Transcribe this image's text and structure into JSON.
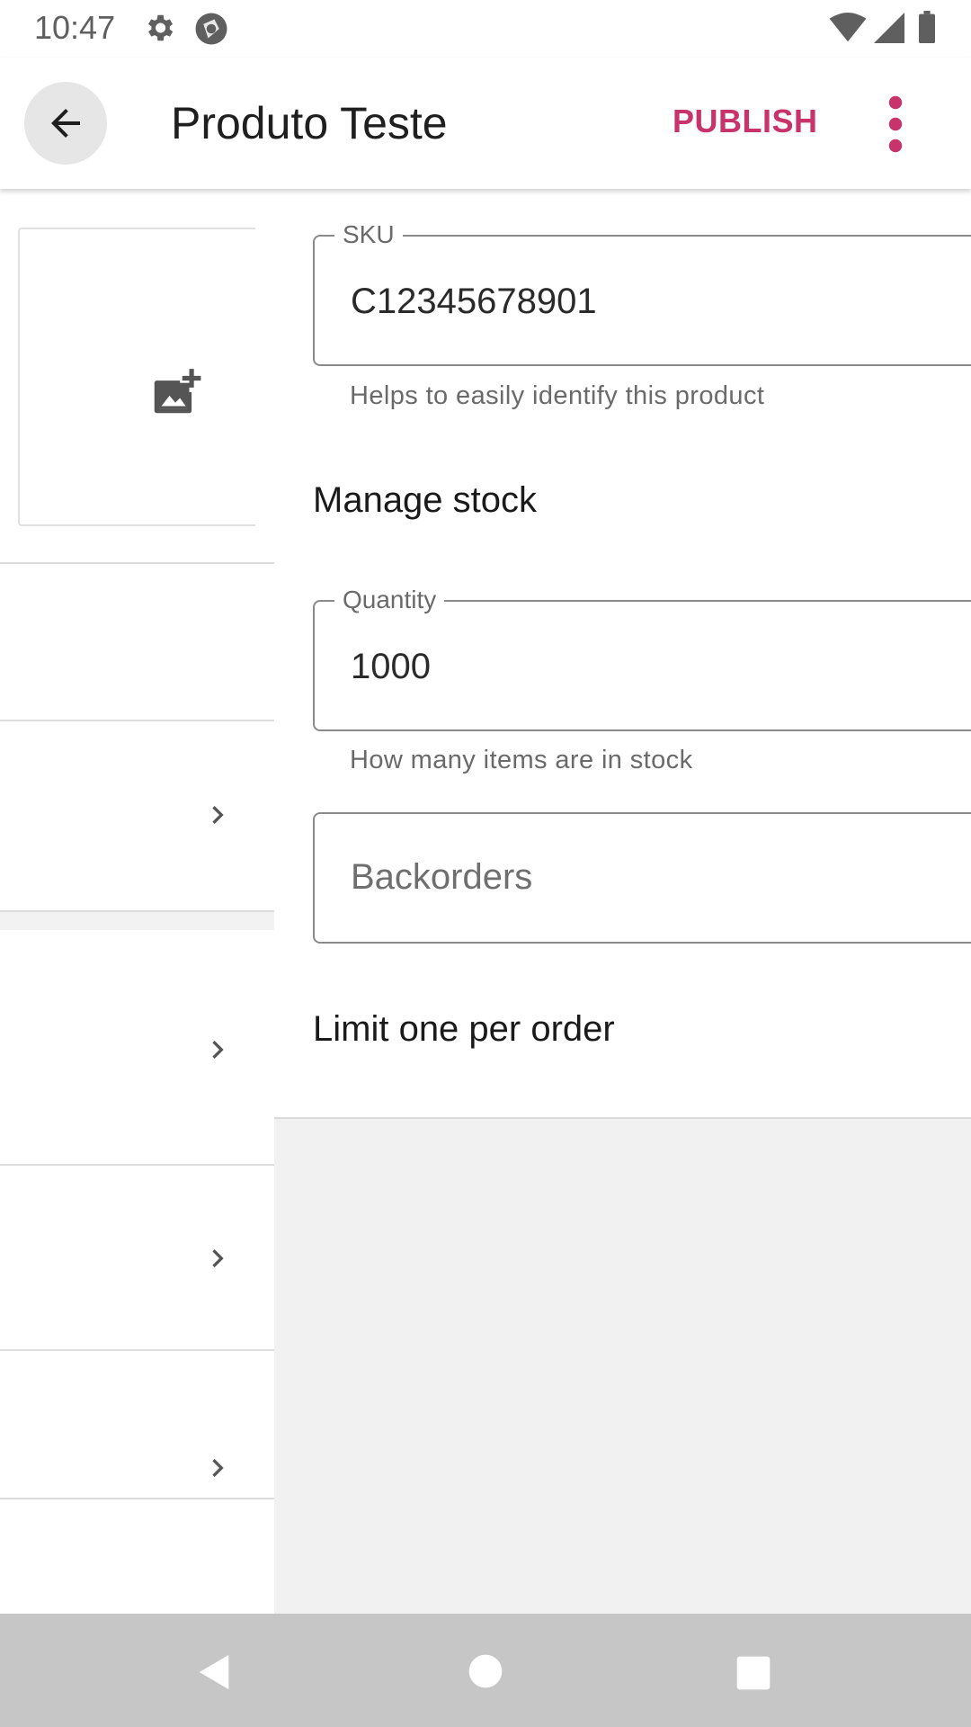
{
  "status_bar": {
    "time": "10:47"
  },
  "app_bar": {
    "title": "Produto Teste",
    "publish_label": "PUBLISH"
  },
  "form": {
    "sku": {
      "label": "SKU",
      "value": "C12345678901",
      "helper": "Helps to easily identify this product"
    },
    "manage_stock_label": "Manage stock",
    "quantity": {
      "label": "Quantity",
      "value": "1000",
      "helper": "How many items are in stock"
    },
    "backorders": {
      "placeholder": "Backorders"
    },
    "limit_one_label": "Limit one per order"
  },
  "colors": {
    "accent": "#c9336b",
    "panel_bg": "#f1f1f1",
    "nav_bar": "#c6c6c6"
  },
  "icons": [
    "gear-icon",
    "app-status-icon",
    "wifi-icon",
    "signal-icon",
    "battery-icon",
    "back-arrow-icon",
    "more-vert-icon",
    "add-photo-icon",
    "chevron-right-icon",
    "nav-back-icon",
    "nav-home-icon",
    "nav-recents-icon"
  ]
}
